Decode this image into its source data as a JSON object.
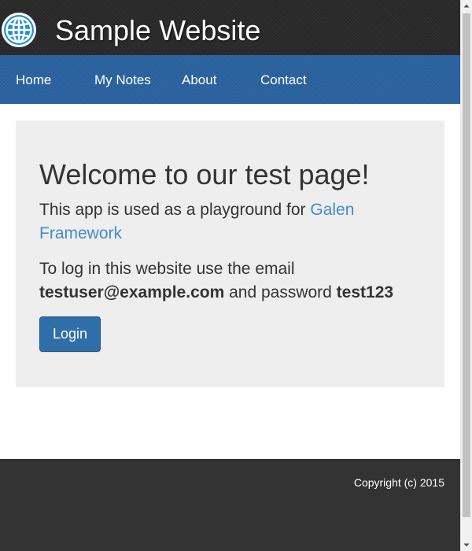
{
  "header": {
    "title": "Sample Website",
    "logo_icon": "globe-icon"
  },
  "nav": {
    "items": [
      {
        "label": "Home"
      },
      {
        "label": "My Notes"
      },
      {
        "label": "About"
      },
      {
        "label": "Contact"
      }
    ]
  },
  "main": {
    "heading": "Welcome to our test page!",
    "intro_prefix": "This app is used as a playground for ",
    "intro_link": "Galen Framework",
    "login_prefix": "To log in this website use the email ",
    "email": "testuser@example.com",
    "login_middle": " and password ",
    "password": "test123",
    "login_button": "Login"
  },
  "footer": {
    "copyright": "Copyright (c) 2015"
  },
  "colors": {
    "header_bg": "#2a2a2a",
    "nav_bg": "#2a62a0",
    "link": "#428bca",
    "button_bg": "#2f6ea8",
    "jumbotron_bg": "#eeeeee",
    "footer_bg": "#333333"
  },
  "scrollbar": {
    "up_icon": "scroll-up-arrow-icon",
    "down_icon": "scroll-down-arrow-icon"
  }
}
